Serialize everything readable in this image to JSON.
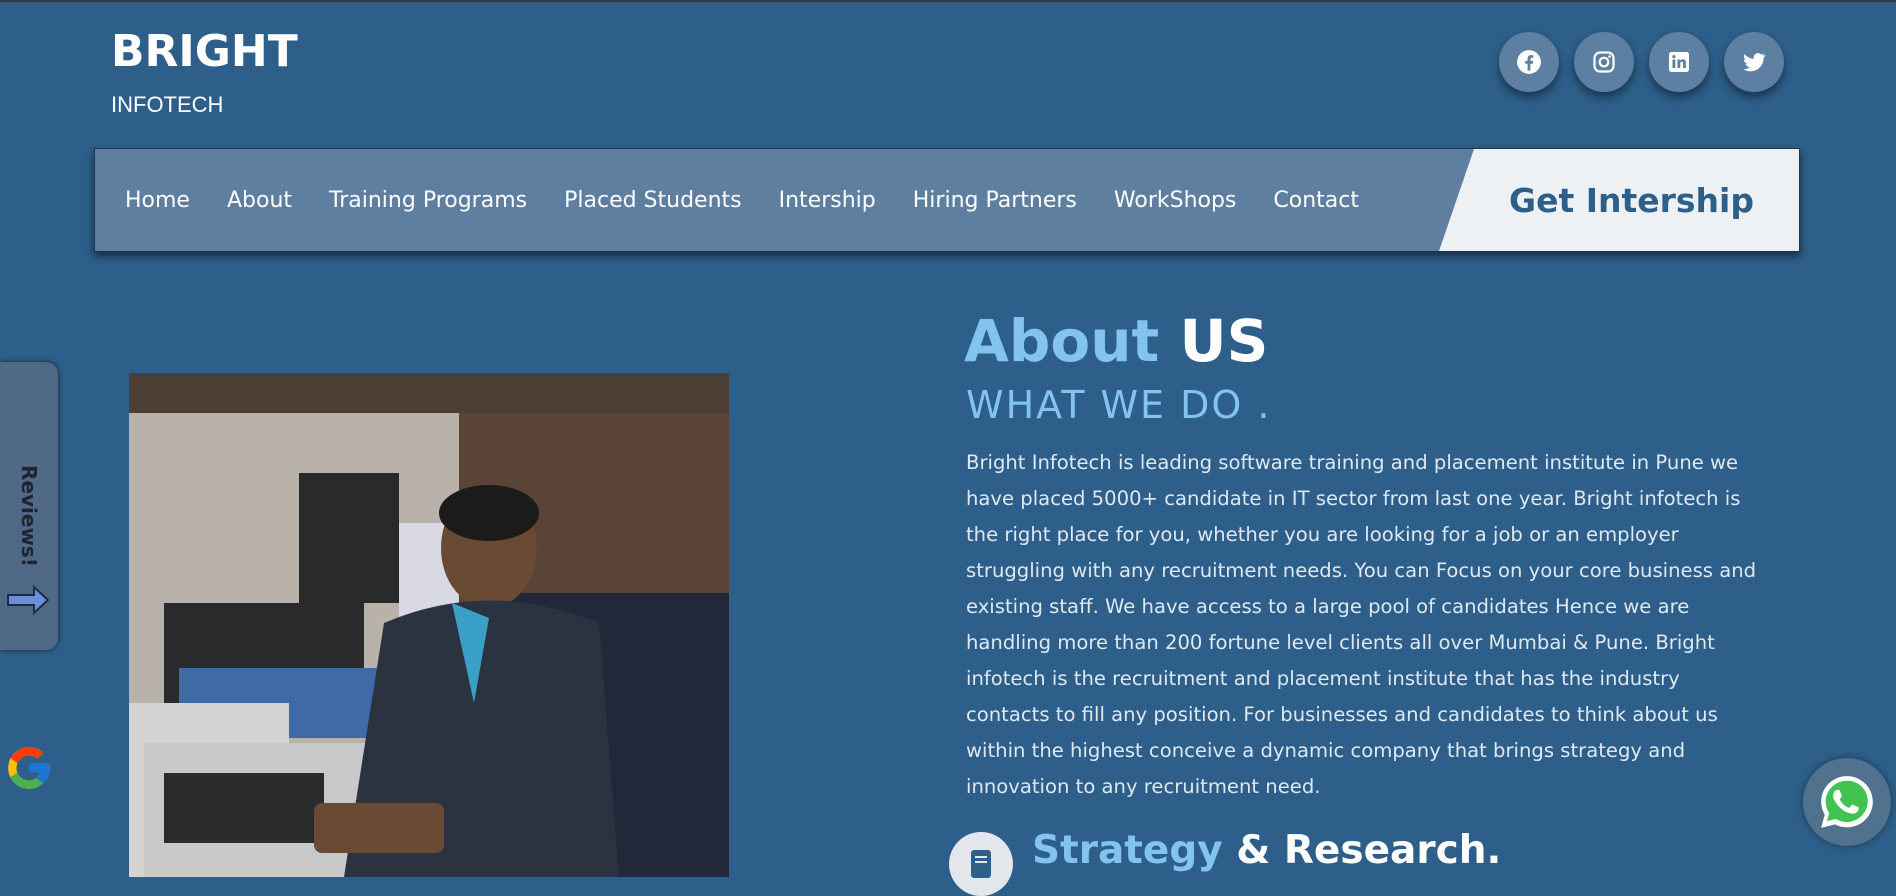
{
  "brand": {
    "title": "BRIGHT",
    "subtitle": "INFOTECH"
  },
  "social": [
    "facebook-icon",
    "instagram-icon",
    "linkedin-icon",
    "twitter-icon"
  ],
  "nav": {
    "links": [
      "Home",
      "About",
      "Training Programs",
      "Placed Students",
      "Intership",
      "Hiring Partners",
      "WorkShops",
      "Contact"
    ],
    "cta": "Get Intership"
  },
  "about": {
    "heading_accent": "About",
    "heading_rest": "US",
    "subheading": "WHAT WE DO .",
    "paragraph": "Bright Infotech is leading software training and placement institute in Pune we have placed 5000+ candidate in IT sector from last one year. Bright infotech is the right place for you, whether you are looking for a job or an employer struggling with any recruitment needs. You can Focus on your core business and existing staff. We have access to a large pool of candidates Hence we are handling more than 200 fortune level clients all over Mumbai & Pune. Bright infotech is the recruitment and placement institute that has the industry contacts to fill any position. For businesses and candidates to think about us within the highest conceive a dynamic company that brings strategy and innovation to any recruitment need.",
    "strategy_accent": "Strategy",
    "strategy_rest": "& Research."
  },
  "reviews": {
    "label": "Reviews!"
  },
  "colors": {
    "background": "#2d5f8a",
    "navbar": "#5e7fa0",
    "accent": "#82c4ec",
    "cta_bg": "#eef1f4"
  }
}
